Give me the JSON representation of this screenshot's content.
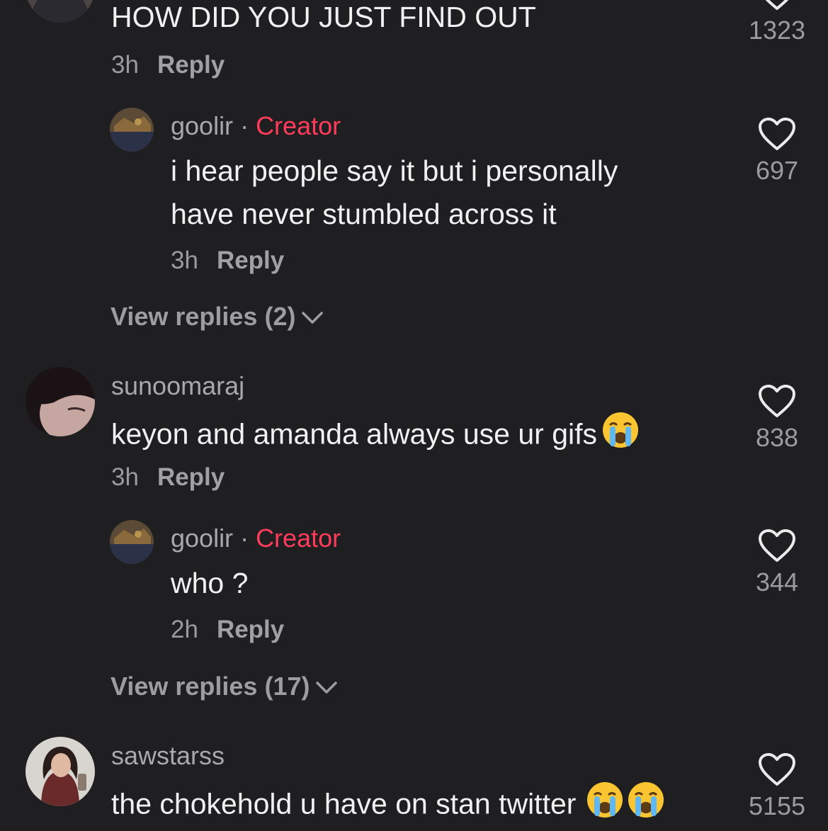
{
  "comments": [
    {
      "text": "HOW DID YOU JUST FIND OUT",
      "time": "3h",
      "reply_label": "Reply",
      "likes": "1323"
    },
    {
      "username": "goolir",
      "separator": "·",
      "badge": "Creator",
      "text_lines": [
        "i hear people say it but i personally",
        "have never stumbled across it"
      ],
      "time": "3h",
      "reply_label": "Reply",
      "likes": "697"
    },
    {
      "view_replies": "View replies (2)"
    },
    {
      "username": "sunoomaraj",
      "text": "keyon and amanda always use ur gifs",
      "emoji": "loudly-crying-face",
      "time": "3h",
      "reply_label": "Reply",
      "likes": "838"
    },
    {
      "username": "goolir",
      "separator": "·",
      "badge": "Creator",
      "text": "who ?",
      "time": "2h",
      "reply_label": "Reply",
      "likes": "344"
    },
    {
      "view_replies": "View replies (17)"
    },
    {
      "username": "sawstarss",
      "text": "the chokehold u have on stan twitter",
      "emoji": "loudly-crying-face",
      "likes": "5155"
    }
  ],
  "colors": {
    "background": "#1f1f21",
    "creator_badge": "#ff3b5c",
    "muted_text": "#9c9c9e"
  }
}
